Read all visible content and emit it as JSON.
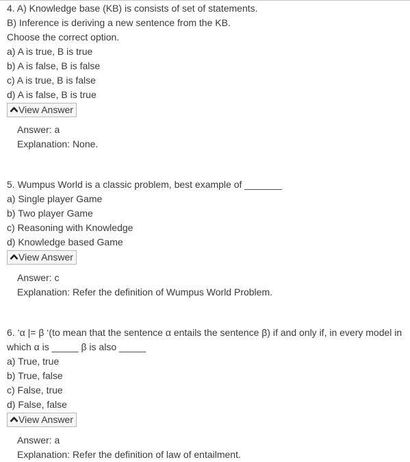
{
  "questions": [
    {
      "lines": [
        "4. A) Knowledge base (KB) is consists of set of statements.",
        "B) Inference is deriving a new sentence from the KB.",
        "Choose the correct option."
      ],
      "options": [
        "a) A is true, B is true",
        "b) A is false, B is false",
        "c) A is true, B is false",
        "d) A is false, B is true"
      ],
      "button_label": "View Answer",
      "answer": "Answer: a",
      "explanation": "Explanation: None."
    },
    {
      "lines": [
        "5. Wumpus World is a classic problem, best example of _______"
      ],
      "options": [
        "a) Single player Game",
        "b) Two player Game",
        "c) Reasoning with Knowledge",
        "d) Knowledge based Game"
      ],
      "button_label": "View Answer",
      "answer": "Answer: c",
      "explanation": "Explanation: Refer the definition of Wumpus World Problem."
    },
    {
      "lines": [
        "6. ‘α |= β ‘(to mean that the sentence α entails the sentence β) if and only if, in every model in",
        "which α is _____ β is also _____"
      ],
      "options": [
        "a) True, true",
        "b) True, false",
        "c) False, true",
        "d) False, false"
      ],
      "button_label": "View Answer",
      "answer": "Answer: a",
      "explanation": "Explanation: Refer the definition of law of entailment."
    }
  ]
}
